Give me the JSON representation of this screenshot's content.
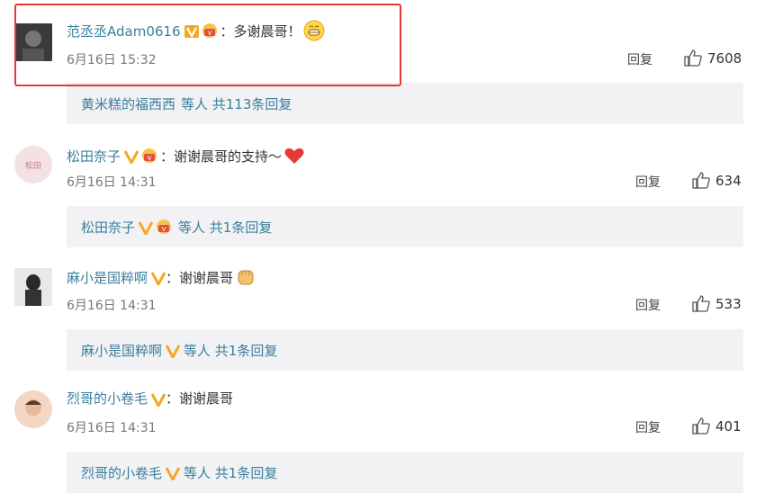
{
  "comments": [
    {
      "username": "范丞丞Adam0616",
      "text": "：多谢晨哥！",
      "time": "6月16日 15:32",
      "reply_label": "回复",
      "likes": "7608",
      "emoji": "grin-emoji",
      "subreplies": {
        "user": "黄米糕的福西西",
        "suffix": "等人 共113条回复"
      }
    },
    {
      "username": "松田奈子",
      "text": "：谢谢晨哥的支持～",
      "time": "6月16日 14:31",
      "reply_label": "回复",
      "likes": "634",
      "emoji": "heart-emoji",
      "subreplies": {
        "user": "松田奈子",
        "suffix": "等人 共1条回复"
      }
    },
    {
      "username": "麻小是国粹啊",
      "text": "：谢谢晨哥",
      "time": "6月16日 14:31",
      "reply_label": "回复",
      "likes": "533",
      "emoji": "fist-emoji",
      "subreplies": {
        "user": "麻小是国粹啊",
        "suffix": "等人 共1条回复"
      }
    },
    {
      "username": "烈哥的小卷毛",
      "text": "：谢谢晨哥",
      "time": "6月16日 14:31",
      "reply_label": "回复",
      "likes": "401",
      "emoji": "",
      "subreplies": {
        "user": "烈哥的小卷毛",
        "suffix": "等人 共1条回复"
      }
    }
  ],
  "colors": {
    "username_blue": "#3a7f9d",
    "verified_gold": "#f5a623",
    "highlight_red": "#e53935",
    "reply_bg": "#f2f2f5"
  }
}
